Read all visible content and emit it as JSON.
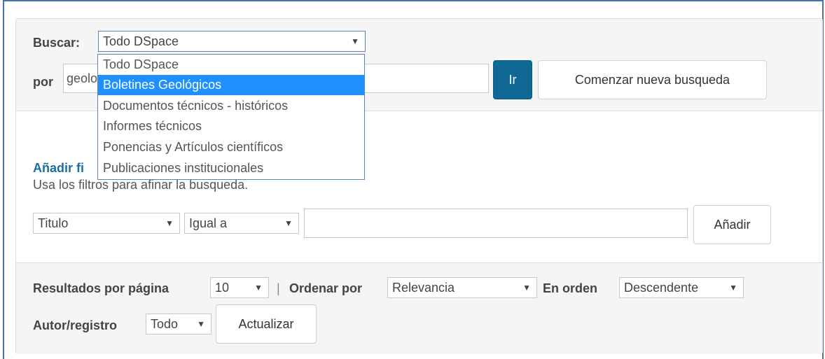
{
  "search": {
    "scope_label": "Buscar:",
    "scope_selected": "Todo DSpace",
    "query_label": "por",
    "query_value": "geolo",
    "go_button": "Ir",
    "new_search_button": "Comenzar nueva busqueda",
    "scope_options": [
      "Todo DSpace",
      "Boletines Geológicos",
      "Documentos técnicos - históricos",
      "Informes técnicos",
      "Ponencias y Artículos científicos",
      "Publicaciones institucionales"
    ],
    "highlighted_option": "Boletines Geológicos"
  },
  "filters": {
    "heading": "Añadir fi",
    "hint": "Usa los filtros para afinar la busqueda.",
    "field_selected": "Titulo",
    "operator_selected": "Igual a",
    "value": "",
    "add_button": "Añadir"
  },
  "results": {
    "per_page_label": "Resultados por página",
    "per_page_selected": "10",
    "separator": "|",
    "sort_label": "Ordenar por",
    "sort_selected": "Relevancia",
    "order_label": "En orden",
    "order_selected": "Descendente",
    "author_label": "Autor/registro",
    "author_selected": "Todo",
    "update_button": "Actualizar"
  },
  "colors": {
    "primary_button": "#0f6994",
    "highlight": "#1e90ff",
    "link": "#1a6fa0",
    "panel_bg": "#f5f5f5"
  },
  "icons": {
    "dropdown_arrow": "▼"
  }
}
